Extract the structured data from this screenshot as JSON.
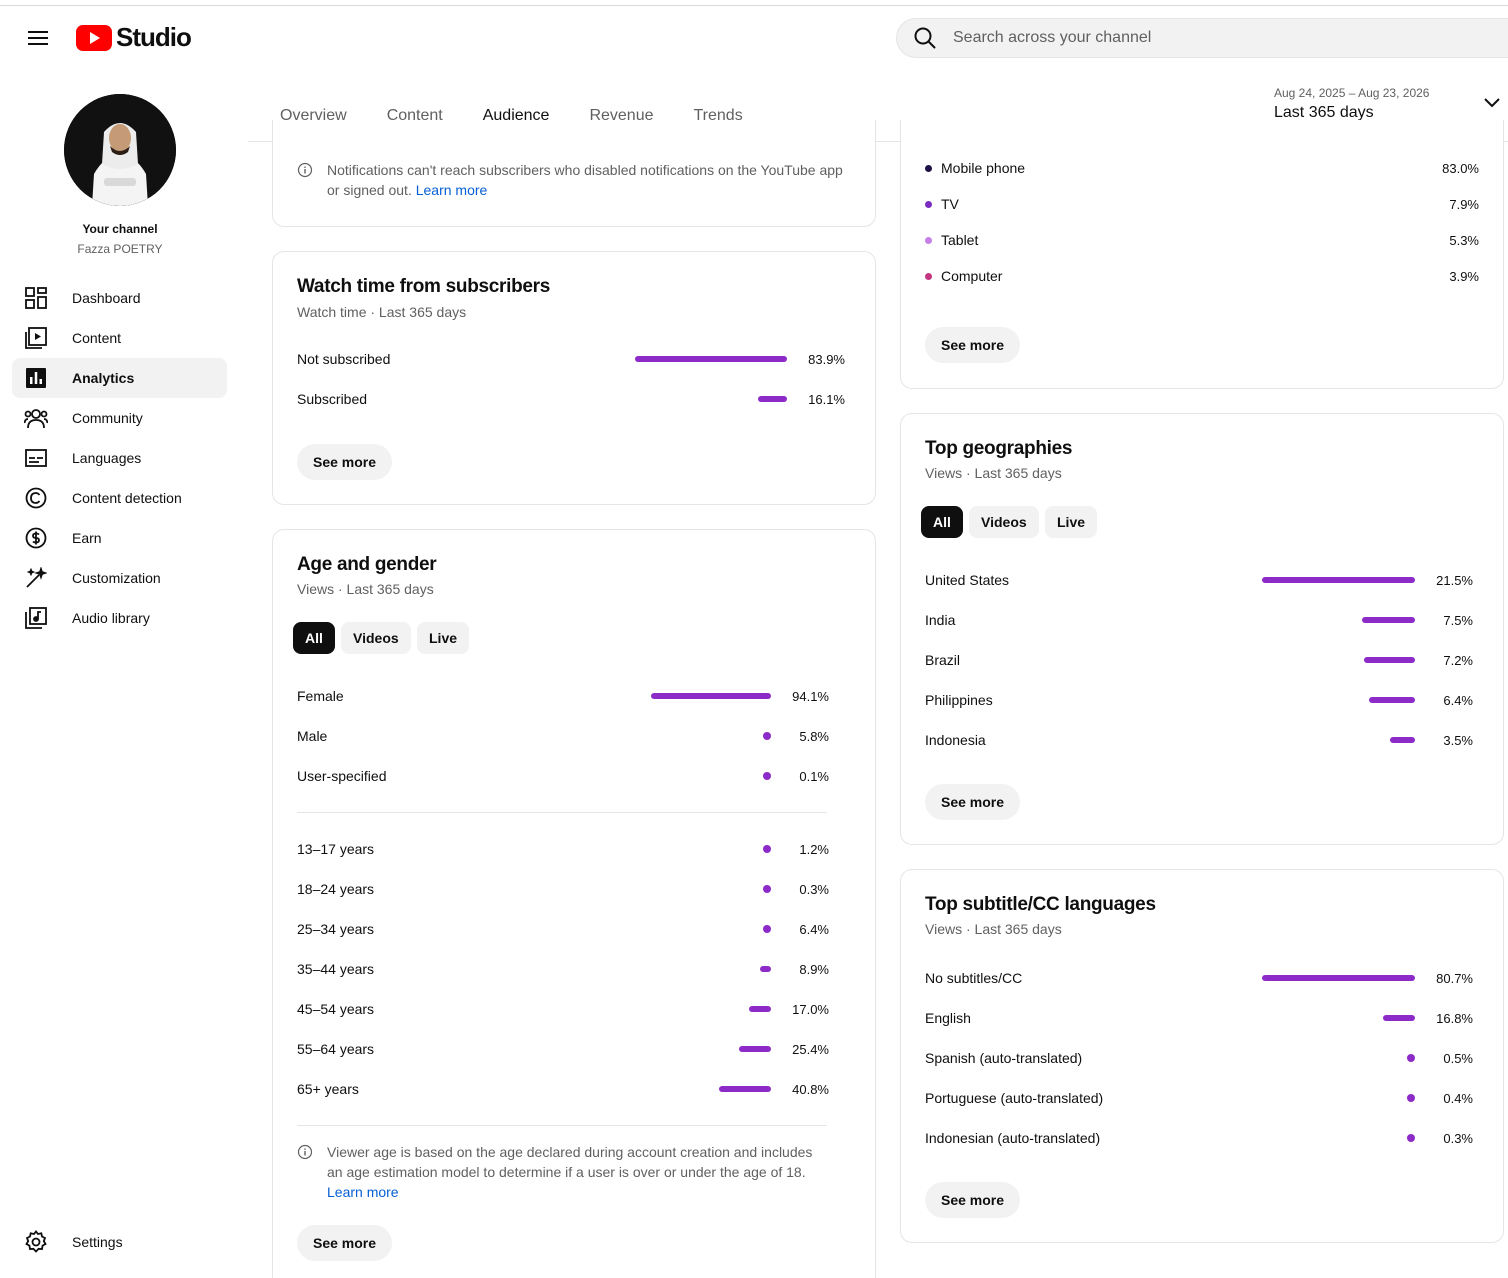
{
  "app": {
    "name": "Studio"
  },
  "search": {
    "placeholder": "Search across your channel"
  },
  "channel": {
    "title": "Your channel",
    "name": "Fazza POETRY"
  },
  "sidebar": {
    "items": [
      {
        "label": "Dashboard",
        "icon": "dashboard-icon"
      },
      {
        "label": "Content",
        "icon": "content-icon"
      },
      {
        "label": "Analytics",
        "icon": "analytics-icon",
        "active": true
      },
      {
        "label": "Community",
        "icon": "community-icon"
      },
      {
        "label": "Languages",
        "icon": "subtitles-icon"
      },
      {
        "label": "Content detection",
        "icon": "copyright-icon"
      },
      {
        "label": "Earn",
        "icon": "dollar-icon"
      },
      {
        "label": "Customization",
        "icon": "magic-wand-icon"
      },
      {
        "label": "Audio library",
        "icon": "audio-library-icon"
      }
    ],
    "settings_label": "Settings"
  },
  "tabs": [
    {
      "label": "Overview"
    },
    {
      "label": "Content"
    },
    {
      "label": "Audience",
      "active": true
    },
    {
      "label": "Revenue"
    },
    {
      "label": "Trends"
    }
  ],
  "date_range": {
    "range": "Aug 24, 2025 – Aug 23, 2026",
    "label": "Last 365 days"
  },
  "notification_card": {
    "text": "Notifications can't reach subscribers who disabled notifications on the YouTube app or signed out.",
    "link": "Learn more"
  },
  "watch_time_subscribers": {
    "title": "Watch time from subscribers",
    "subtitle": "Watch time · Last 365 days",
    "rows": [
      {
        "label": "Not subscribed",
        "value": "83.9%",
        "pct": 83.9
      },
      {
        "label": "Subscribed",
        "value": "16.1%",
        "pct": 16.1
      }
    ],
    "see_more": "See more"
  },
  "age_gender": {
    "title": "Age and gender",
    "subtitle": "Views · Last 365 days",
    "chips": [
      "All",
      "Videos",
      "Live"
    ],
    "gender": [
      {
        "label": "Female",
        "value": "94.1%",
        "pct": 94.1
      },
      {
        "label": "Male",
        "value": "5.8%",
        "pct": 5.8
      },
      {
        "label": "User-specified",
        "value": "0.1%",
        "pct": 0.1
      }
    ],
    "ages": [
      {
        "label": "13–17 years",
        "value": "1.2%",
        "pct": 1.2
      },
      {
        "label": "18–24 years",
        "value": "0.3%",
        "pct": 0.3
      },
      {
        "label": "25–34 years",
        "value": "6.4%",
        "pct": 6.4
      },
      {
        "label": "35–44 years",
        "value": "8.9%",
        "pct": 8.9
      },
      {
        "label": "45–54 years",
        "value": "17.0%",
        "pct": 17.0
      },
      {
        "label": "55–64 years",
        "value": "25.4%",
        "pct": 25.4
      },
      {
        "label": "65+ years",
        "value": "40.8%",
        "pct": 40.8
      }
    ],
    "note": "Viewer age is based on the age declared during account creation and includes an age estimation model to determine if a user is over or under the age of 18.",
    "note_link": "Learn more",
    "see_more": "See more"
  },
  "devices": {
    "rows": [
      {
        "label": "Mobile phone",
        "value": "83.0%",
        "color": "#1f1147"
      },
      {
        "label": "TV",
        "value": "7.9%",
        "color": "#7a2cc0"
      },
      {
        "label": "Tablet",
        "value": "5.3%",
        "color": "#c57fe6"
      },
      {
        "label": "Computer",
        "value": "3.9%",
        "color": "#c2357f"
      }
    ],
    "see_more": "See more"
  },
  "geographies": {
    "title": "Top geographies",
    "subtitle": "Views · Last 365 days",
    "chips": [
      "All",
      "Videos",
      "Live"
    ],
    "rows": [
      {
        "label": "United States",
        "value": "21.5%",
        "pct": 21.5
      },
      {
        "label": "India",
        "value": "7.5%",
        "pct": 7.5
      },
      {
        "label": "Brazil",
        "value": "7.2%",
        "pct": 7.2
      },
      {
        "label": "Philippines",
        "value": "6.4%",
        "pct": 6.4
      },
      {
        "label": "Indonesia",
        "value": "3.5%",
        "pct": 3.5
      }
    ],
    "see_more": "See more"
  },
  "subtitles": {
    "title": "Top subtitle/CC languages",
    "subtitle": "Views · Last 365 days",
    "rows": [
      {
        "label": "No subtitles/CC",
        "value": "80.7%",
        "pct": 80.7
      },
      {
        "label": "English",
        "value": "16.8%",
        "pct": 16.8
      },
      {
        "label": "Spanish (auto-translated)",
        "value": "0.5%",
        "pct": 0.5
      },
      {
        "label": "Portuguese (auto-translated)",
        "value": "0.4%",
        "pct": 0.4
      },
      {
        "label": "Indonesian (auto-translated)",
        "value": "0.3%",
        "pct": 0.3
      }
    ],
    "see_more": "See more"
  },
  "colors": {
    "accent_bar": "#8c2bc8",
    "link": "#065fd4",
    "brand_red": "#ff0000"
  }
}
